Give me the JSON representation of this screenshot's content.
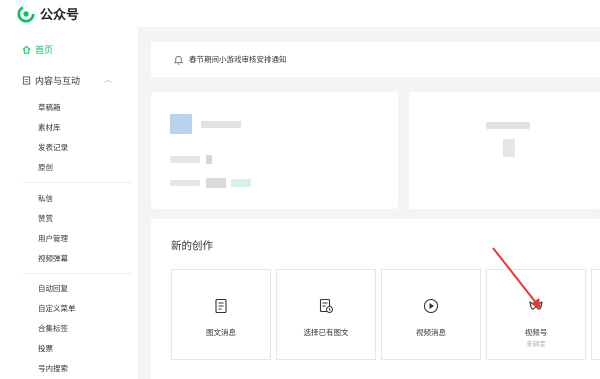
{
  "app": {
    "name": "公众号",
    "brand_color": "#07c160"
  },
  "sidebar": {
    "home": {
      "label": "首页",
      "icon": "home-icon"
    },
    "group": {
      "label": "内容与互动",
      "icon": "document-icon",
      "chevron": "︿"
    },
    "items": [
      "草稿箱",
      "素材库",
      "发表记录",
      "原创",
      "私信",
      "赞赏",
      "用户管理",
      "视频弹幕",
      "自动回复",
      "自定义菜单",
      "合集标签",
      "投票",
      "号内搜索"
    ]
  },
  "notice": {
    "text": "春节期间小游戏审核安排通知",
    "icon": "bell-icon"
  },
  "create": {
    "title": "新的创作",
    "tiles": [
      {
        "label": "图文消息",
        "sub": "",
        "icon": "article-icon"
      },
      {
        "label": "选择已有图文",
        "sub": "",
        "icon": "select-article-icon"
      },
      {
        "label": "视频消息",
        "sub": "",
        "icon": "play-icon"
      },
      {
        "label": "视频号",
        "sub": "未绑定",
        "icon": "channels-icon"
      }
    ]
  }
}
